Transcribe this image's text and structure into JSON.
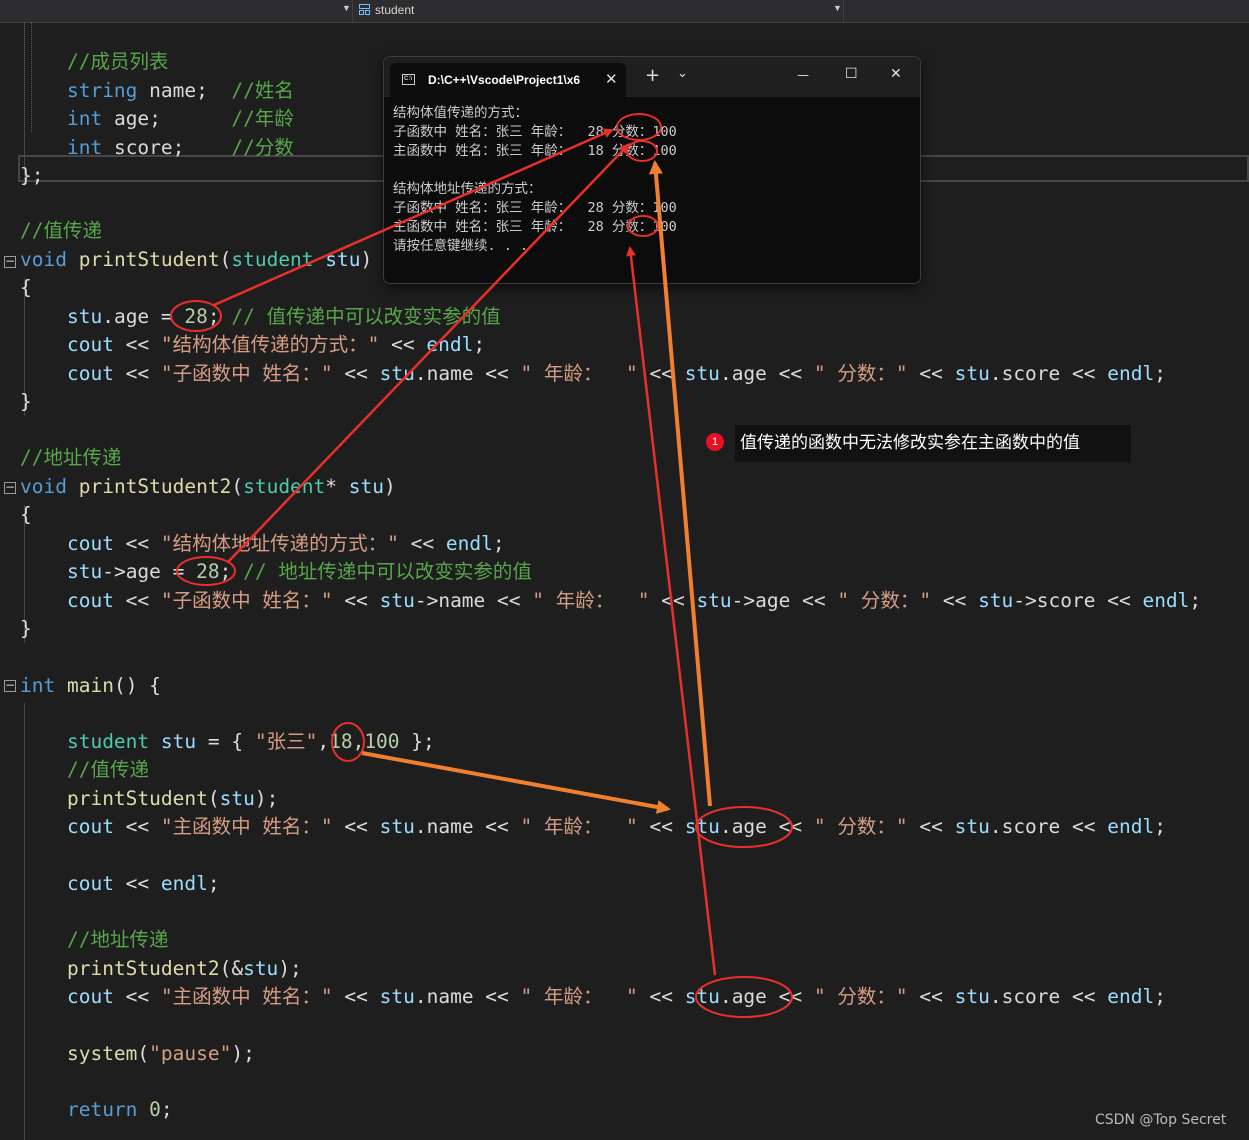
{
  "toolbar": {
    "scope_value": "student"
  },
  "code": {
    "comment_members": "//成员列表",
    "field_name": {
      "type": "string",
      "name": "name",
      "comment": "//姓名"
    },
    "field_age": {
      "type": "int",
      "name": "age",
      "comment": "//年龄"
    },
    "field_score": {
      "type": "int",
      "name": "score",
      "comment": "//分数"
    },
    "struct_close": "};",
    "comment_value_pass": "//值传递",
    "func1": {
      "ret": "void",
      "name": "printStudent",
      "param_type": "student",
      "param": "stu"
    },
    "brace_open": "{",
    "brace_close": "}",
    "f1_assign": {
      "obj": "stu",
      "member": "age",
      "value": "28",
      "comment": "// 值传递中可以改变实参的值"
    },
    "f1_cout1": {
      "str": "\"结构体值传递的方式：\""
    },
    "f1_cout2": {
      "str_name": "\"子函数中 姓名：\"",
      "str_age": "\" 年龄：  \"",
      "str_score": "\" 分数：\""
    },
    "comment_addr_pass": "//地址传递",
    "func2": {
      "ret": "void",
      "name": "printStudent2",
      "param_type": "student",
      "param": "stu"
    },
    "f2_cout1": {
      "str": "\"结构体地址传递的方式：\""
    },
    "f2_assign": {
      "value": "28",
      "comment": "// 地址传递中可以改变实参的值"
    },
    "main": {
      "ret": "int",
      "name": "main"
    },
    "main_init": {
      "type": "student",
      "var": "stu",
      "str": "\"张三\"",
      "age": "18",
      "score": "100"
    },
    "main_comment_value": "//值传递",
    "main_call1": "printStudent",
    "main_cout_str_name": "\"主函数中 姓名：\"",
    "main_comment_addr": "//地址传递",
    "main_call2": "printStudent2",
    "system_fn": "system",
    "system_arg": "\"pause\"",
    "return_kw": "return",
    "return_val": "0"
  },
  "console": {
    "tab_title": "D:\\C++\\Vscode\\Project1\\x6",
    "tab_close": "✕",
    "new_tab": "+",
    "dropdown": "⌄",
    "min": "—",
    "max": "☐",
    "close": "✕",
    "lines": [
      "结构体值传递的方式：",
      "子函数中 姓名：张三 年龄：  28 分数：100",
      "主函数中 姓名：张三 年龄：  18 分数：100",
      "",
      "结构体地址传递的方式：",
      "子函数中 姓名：张三 年龄：  28 分数：100",
      "主函数中 姓名：张三 年龄：  28 分数：100",
      "请按任意键继续. . ."
    ]
  },
  "annotation": {
    "badge": "1",
    "text": "值传递的函数中无法修改实参在主函数中的值"
  },
  "watermark": "CSDN @Top Secret",
  "colors": {
    "editor_bg": "#1e1e1e",
    "annotation_red": "#e8302a",
    "annotation_orange": "#f08030"
  }
}
